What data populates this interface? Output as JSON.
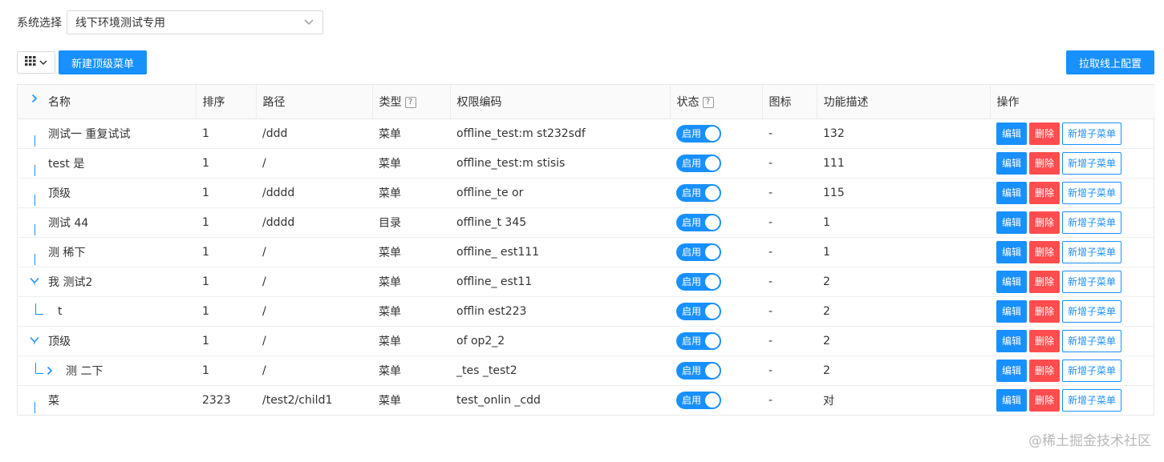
{
  "system": {
    "label": "系统选择",
    "selected": "线下环境测试专用"
  },
  "toolbar": {
    "columns_icon": "grid-icon",
    "new_top_menu": "新建顶级菜单",
    "pull_online_config": "拉取线上配置"
  },
  "table": {
    "headers": {
      "name": "名称",
      "sort": "排序",
      "path": "路径",
      "type": "类型",
      "code": "权限编码",
      "status": "状态",
      "icon": "图标",
      "desc": "功能描述",
      "ops": "操作"
    },
    "help_mark": "?",
    "rows": [
      {
        "name": "测试一 重复试试",
        "sort": "1",
        "path": "/ddd",
        "type": "菜单",
        "code": "offline_test:m st232sdf",
        "status": "启用",
        "icon": "-",
        "desc": "132"
      },
      {
        "name": "test 是",
        "sort": "1",
        "path": "/",
        "type": "菜单",
        "code": "offline_test:m stisis",
        "status": "启用",
        "icon": "-",
        "desc": "111"
      },
      {
        "name": "顶级",
        "sort": "1",
        "path": "/dddd",
        "type": "菜单",
        "code": "offline_te or",
        "status": "启用",
        "icon": "-",
        "desc": "115"
      },
      {
        "name": "测试 44",
        "sort": "1",
        "path": "/dddd",
        "type": "目录",
        "code": "offline_t 345",
        "status": "启用",
        "icon": "-",
        "desc": "1"
      },
      {
        "name": "测 稀下",
        "sort": "1",
        "path": "/",
        "type": "菜单",
        "code": "offline_ est111",
        "status": "启用",
        "icon": "-",
        "desc": "1"
      },
      {
        "name": "我 测试2",
        "sort": "1",
        "path": "/",
        "type": "菜单",
        "code": "offline_ est11",
        "status": "启用",
        "icon": "-",
        "desc": "2"
      },
      {
        "name": "t",
        "sort": "1",
        "path": "/",
        "type": "菜单",
        "code": "offlin est223",
        "status": "启用",
        "icon": "-",
        "desc": "2"
      },
      {
        "name": "顶级",
        "sort": "1",
        "path": "/",
        "type": "菜单",
        "code": "of op2_2",
        "status": "启用",
        "icon": "-",
        "desc": "2"
      },
      {
        "name": "测 二下",
        "sort": "1",
        "path": "/",
        "type": "菜单",
        "code": "_tes _test2",
        "status": "启用",
        "icon": "-",
        "desc": "2"
      },
      {
        "name": "菜",
        "sort": "2323",
        "path": "/test2/child1",
        "type": "菜单",
        "code": "test_onlin _cdd",
        "status": "启用",
        "icon": "-",
        "desc": "对"
      }
    ],
    "op_labels": {
      "edit": "编辑",
      "delete": "删除",
      "add_child": "新增子菜单"
    }
  },
  "watermark": "@稀土掘金技术社区",
  "colors": {
    "primary": "#1890ff",
    "danger": "#ff4d4f",
    "header_bg": "#fafafa"
  }
}
